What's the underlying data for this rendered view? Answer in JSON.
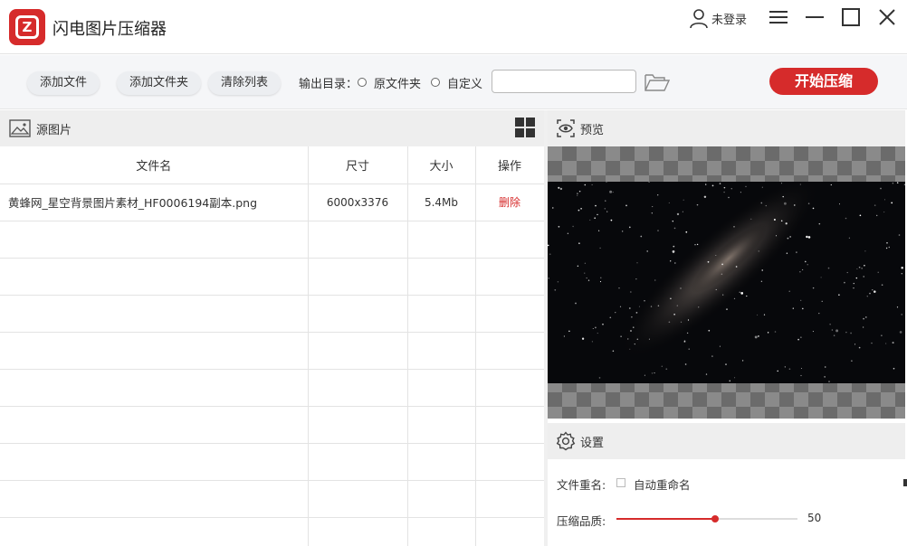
{
  "app": {
    "title": "闪电图片压缩器",
    "logo_letter": "Z",
    "user_label": "未登录"
  },
  "toolbar": {
    "add_file": "添加文件",
    "add_folder": "添加文件夹",
    "clear_list": "清除列表",
    "output_label": "输出目录：",
    "option_original": "原文件夹",
    "option_custom": "自定义",
    "path_value": "",
    "start_button": "开始压缩"
  },
  "source_panel": {
    "title": "源图片",
    "columns": [
      "文件名",
      "尺寸",
      "大小",
      "操作"
    ],
    "rows": [
      {
        "name": "黄蜂网_星空背景图片素材_HF0006194副本.png",
        "dimensions": "6000x3376",
        "size": "5.4Mb",
        "action": "删除"
      }
    ]
  },
  "preview_panel": {
    "title": "预览"
  },
  "settings_panel": {
    "title": "设置",
    "rename_label": "文件重名:",
    "auto_rename_label": "自动重命名",
    "auto_rename_checked": false,
    "quality_label": "压缩品质:",
    "quality_value": 50,
    "quality_max": 100
  },
  "colors": {
    "accent": "#d62b2b",
    "toolbar_bg": "#f5f6f8",
    "panel_header_bg": "#eeeeee"
  }
}
